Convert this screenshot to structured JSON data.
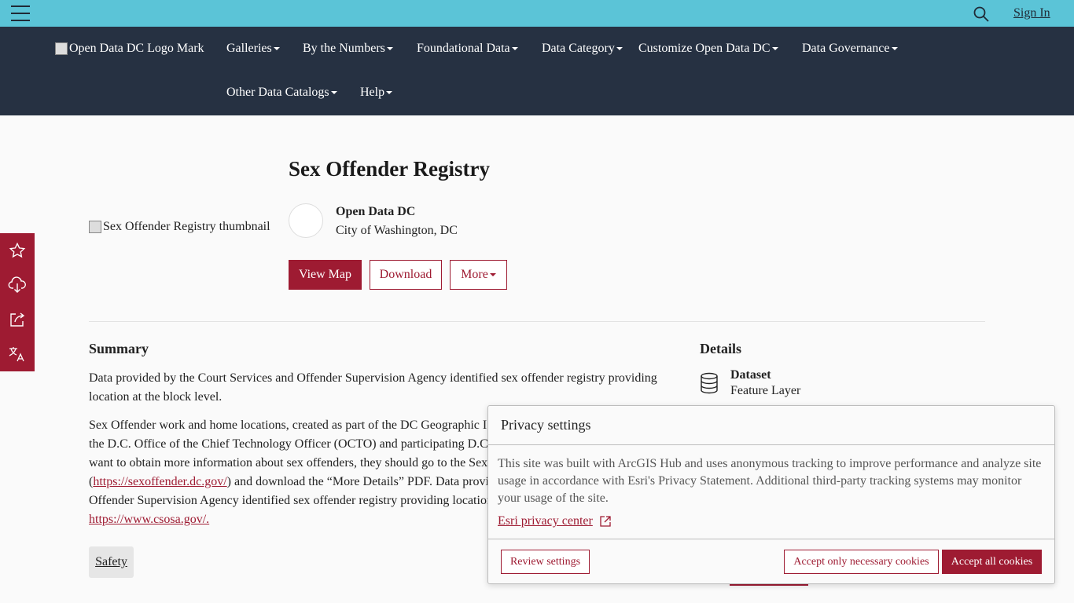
{
  "topbar": {
    "menu_icon": "hamburger-menu-icon",
    "search_icon": "search-icon",
    "sign_in": "Sign In"
  },
  "nav": {
    "logo_alt": "Open Data DC Logo Mark",
    "items": [
      "Galleries",
      "By the Numbers",
      "Foundational Data",
      "Data Category",
      "Customize Open Data DC",
      "Data Governance",
      "Other Data Catalogs",
      "Help"
    ]
  },
  "side_actions": {
    "icons": [
      "star-icon",
      "cloud-download-icon",
      "share-icon",
      "translate-icon"
    ]
  },
  "hero": {
    "thumbnail_alt": "Sex Offender Registry thumbnail",
    "title": "Sex Offender Registry",
    "org_name": "Open Data DC",
    "org_location": "City of Washington, DC",
    "view_map": "View Map",
    "download": "Download",
    "more": "More"
  },
  "summary": {
    "heading": "Summary",
    "para1": "Data provided by the Court Services and Offender Supervision Agency identified sex offender registry providing location at the block level.",
    "para2_a": "Sex Offender work and home locations, created as part of the DC Geographic I",
    "para2_b": "the D.C. Office of the Chief Technology Officer (OCTO) and participating D.C",
    "para2_c": "want to obtain more information about sex offenders, they should go to the Sex",
    "para2_link": "https://sexoffender.dc.gov/",
    "para2_d": ") and download the “More Details” PDF. Data provi",
    "para2_e": "Offender Supervision Agency identified sex offender registry providing location",
    "csosa_link": "https://www.csosa.gov/.",
    "tag": "Safety"
  },
  "details": {
    "heading": "Details",
    "icon": "database-icon",
    "type": "Dataset",
    "subtype": "Feature Layer"
  },
  "privacy": {
    "title": "Privacy settings",
    "body": "This site was built with ArcGIS Hub and uses anonymous tracking to improve performance and analyze site usage in accordance with Esri's Privacy Statement. Additional third-party tracking systems may monitor your usage of the site.",
    "link": "Esri privacy center",
    "link_icon": "external-link-icon",
    "review": "Review settings",
    "necessary": "Accept only necessary cookies",
    "accept_all": "Accept all cookies"
  }
}
